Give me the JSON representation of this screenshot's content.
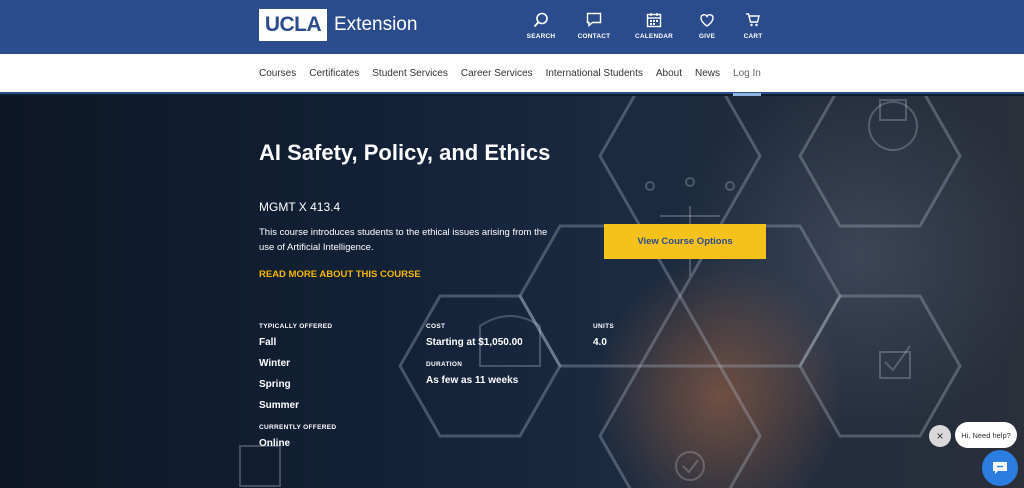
{
  "brand": {
    "logo_text": "UCLA",
    "name": "Extension"
  },
  "util_nav": [
    {
      "label": "SEARCH",
      "icon": "search-icon"
    },
    {
      "label": "CONTACT",
      "icon": "chat-icon"
    },
    {
      "label": "CALENDAR",
      "icon": "calendar-icon"
    },
    {
      "label": "GIVE",
      "icon": "heart-icon"
    },
    {
      "label": "CART",
      "icon": "cart-icon"
    }
  ],
  "main_nav": [
    {
      "label": "Courses"
    },
    {
      "label": "Certificates"
    },
    {
      "label": "Student Services"
    },
    {
      "label": "Career Services"
    },
    {
      "label": "International Students"
    },
    {
      "label": "About"
    },
    {
      "label": "News"
    },
    {
      "label": "Log In"
    }
  ],
  "course": {
    "title": "AI Safety, Policy, and Ethics",
    "code": "MGMT X 413.4",
    "description": "This course introduces students to the ethical issues arising from the use of Artificial Intelligence.",
    "read_more": "READ MORE ABOUT THIS COURSE",
    "cta": "View Course Options"
  },
  "details": {
    "typically_offered_label": "TYPICALLY OFFERED",
    "terms": [
      "Fall",
      "Winter",
      "Spring",
      "Summer"
    ],
    "currently_offered_label": "CURRENTLY OFFERED",
    "currently_offered": "Online",
    "cost_label": "COST",
    "cost": "Starting at $1,050.00",
    "duration_label": "DURATION",
    "duration": "As few as 11 weeks",
    "units_label": "UNITS",
    "units": "4.0"
  },
  "chat": {
    "prompt": "Hi. Need help?",
    "close": "×"
  },
  "colors": {
    "brand_blue": "#2b4c8c",
    "accent_yellow": "#f5c11b",
    "link_gold": "#f5b800"
  }
}
